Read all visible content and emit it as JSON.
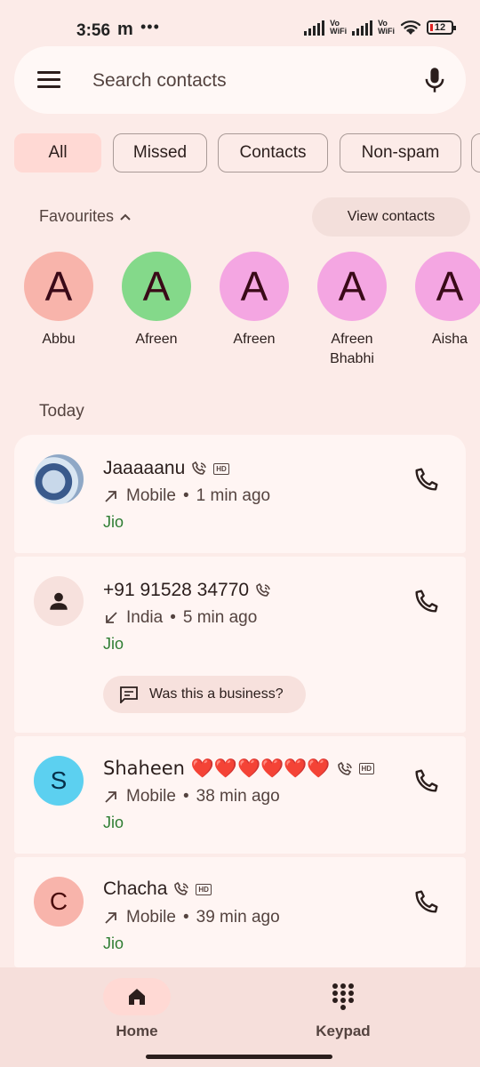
{
  "status_bar": {
    "time": "3:56",
    "app_glyph": "m",
    "dots": "•••",
    "vowifi": "Vo\nWiFi",
    "battery": "12"
  },
  "search": {
    "placeholder": "Search contacts"
  },
  "chips": [
    {
      "label": "All",
      "active": true
    },
    {
      "label": "Missed",
      "active": false
    },
    {
      "label": "Contacts",
      "active": false
    },
    {
      "label": "Non-spam",
      "active": false
    }
  ],
  "favourites": {
    "header": "Favourites",
    "view_contacts_label": "View contacts",
    "items": [
      {
        "initial": "A",
        "name": "Abbu",
        "color": "#f8b4ab"
      },
      {
        "initial": "A",
        "name": "Afreen",
        "color": "#84d98a"
      },
      {
        "initial": "A",
        "name": "Afreen",
        "color": "#f4a6e2"
      },
      {
        "initial": "A",
        "name": "Afreen\nBhabhi",
        "color": "#f4a6e2"
      },
      {
        "initial": "A",
        "name": "Aisha",
        "color": "#f4a6e2"
      }
    ]
  },
  "today_label": "Today",
  "calls": [
    {
      "name": "Jaaaaanu",
      "direction": "outgoing",
      "type": "Mobile",
      "time": "1 min ago",
      "carrier": "Jio",
      "hd": "HD",
      "avatar": "photo"
    },
    {
      "name": "+91 91528 34770",
      "direction": "incoming",
      "type": "India",
      "time": "5 min ago",
      "carrier": "Jio",
      "avatar": "person",
      "business_prompt": "Was this a business?"
    },
    {
      "name": "Shaheen ❤️❤️❤️❤️❤️❤️",
      "direction": "outgoing",
      "type": "Mobile",
      "time": "38 min ago",
      "carrier": "Jio",
      "hd": "HD",
      "avatar": "S",
      "avatar_color": "#5cd0f0"
    },
    {
      "name": "Chacha",
      "direction": "outgoing",
      "type": "Mobile",
      "time": "39 min ago",
      "carrier": "Jio",
      "hd": "HD",
      "avatar": "C",
      "avatar_color": "#f8b4ab"
    }
  ],
  "separator": "•",
  "nav": {
    "home_label": "Home",
    "keypad_label": "Keypad"
  },
  "colors": {
    "accent_pill": "#ffd9d4",
    "carrier_green": "#2e7d32",
    "background": "#fcebe8"
  }
}
